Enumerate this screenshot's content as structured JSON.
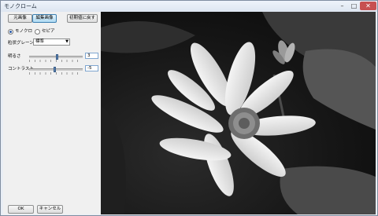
{
  "window": {
    "title": "モノクローム",
    "minimize": "–",
    "maximize": "□",
    "close": "✕"
  },
  "toolbar": {
    "original_label": "元画像",
    "edited_label": "編集画像",
    "reset_label": "初期値に戻す"
  },
  "mode": {
    "mono_label": "モノクロ",
    "sepia_label": "セピア",
    "selected": "mono"
  },
  "grain": {
    "label": "粒状グレーン",
    "value": "標準"
  },
  "brightness": {
    "label": "明るさ",
    "value": "3"
  },
  "contrast": {
    "label": "コントラスト",
    "value": "-5"
  },
  "footer": {
    "ok_label": "OK",
    "cancel_label": "キャンセル"
  },
  "icons": [
    "minimize-icon",
    "maximize-icon",
    "close-icon",
    "chevron-down-icon"
  ]
}
